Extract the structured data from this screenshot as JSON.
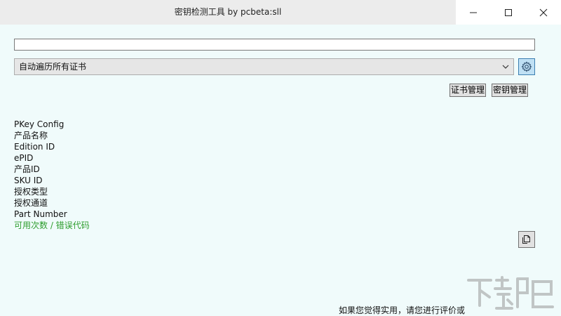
{
  "window": {
    "title": "密钥检测工具 by pcbeta:sll"
  },
  "key_input": {
    "value": "",
    "placeholder": ""
  },
  "cert_select": {
    "selected": "自动遍历所有证书"
  },
  "buttons": {
    "cert_manage": "证书管理",
    "key_manage": "密钥管理"
  },
  "info_lines": [
    "PKey Config",
    "产品名称",
    "Edition ID",
    "ePID",
    "产品ID",
    "SKU ID",
    "授权类型",
    "授权通道",
    "Part Number"
  ],
  "uses_error_line": "可用次数 / 错误代码",
  "footer": {
    "text": "如果您觉得实用，请您进行评价或"
  },
  "colors": {
    "background": "#f0fbfb",
    "accent_green": "#2e9e2e",
    "settings_bg": "#bfe0f4"
  },
  "icons": {
    "minimize": "minimize-icon",
    "maximize": "maximize-icon",
    "close": "close-icon",
    "settings": "gear-icon",
    "copy": "copy-icon",
    "dropdown": "chevron-down-icon"
  }
}
